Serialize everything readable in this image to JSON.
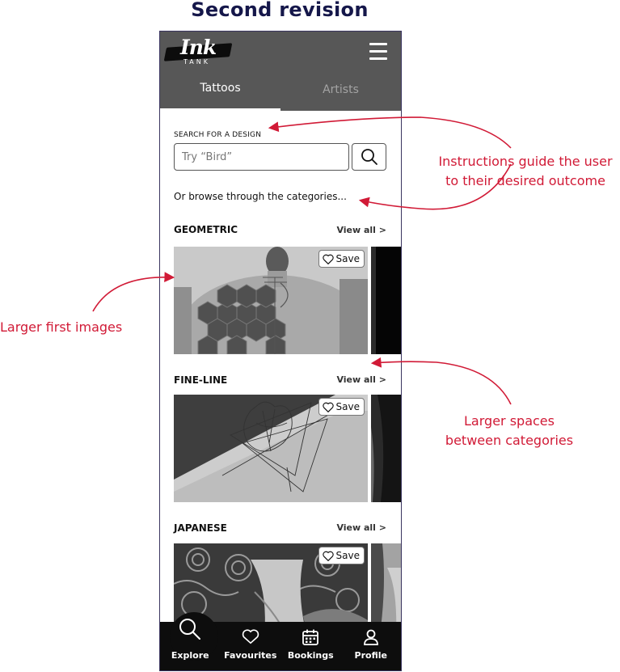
{
  "page": {
    "title": "Second revision"
  },
  "header": {
    "logo_main": "Ink",
    "logo_sub": "TANK",
    "menu_icon": "hamburger-menu-icon"
  },
  "tabs": [
    {
      "label": "Tattoos",
      "active": true
    },
    {
      "label": "Artists",
      "active": false
    }
  ],
  "search": {
    "label": "SEARCH FOR A DESIGN",
    "placeholder": "Try “Bird”",
    "value": "",
    "icon": "search-icon"
  },
  "browse_text": "Or browse through the categories...",
  "categories": [
    {
      "title": "GEOMETRIC",
      "view_all": "View all >",
      "save_label": "Save"
    },
    {
      "title": "FINE-LINE",
      "view_all": "View all >",
      "save_label": "Save"
    },
    {
      "title": "JAPANESE",
      "view_all": "View all >",
      "save_label": "Save"
    }
  ],
  "bottom_nav": [
    {
      "label": "Explore",
      "icon": "search-icon",
      "active": true
    },
    {
      "label": "Favourites",
      "icon": "heart-icon",
      "active": false
    },
    {
      "label": "Bookings",
      "icon": "calendar-icon",
      "active": false
    },
    {
      "label": "Profile",
      "icon": "user-icon",
      "active": false
    }
  ],
  "annotations": {
    "instructions_line1": "Instructions guide the user",
    "instructions_line2": "to their desired outcome",
    "larger_images": "Larger first images",
    "spaces_line1": "Larger spaces",
    "spaces_line2": "between categories"
  },
  "colors": {
    "header_bg": "#575757",
    "nav_bg": "#0d0d0d",
    "annotation": "#d11a36",
    "title": "#15174a"
  }
}
